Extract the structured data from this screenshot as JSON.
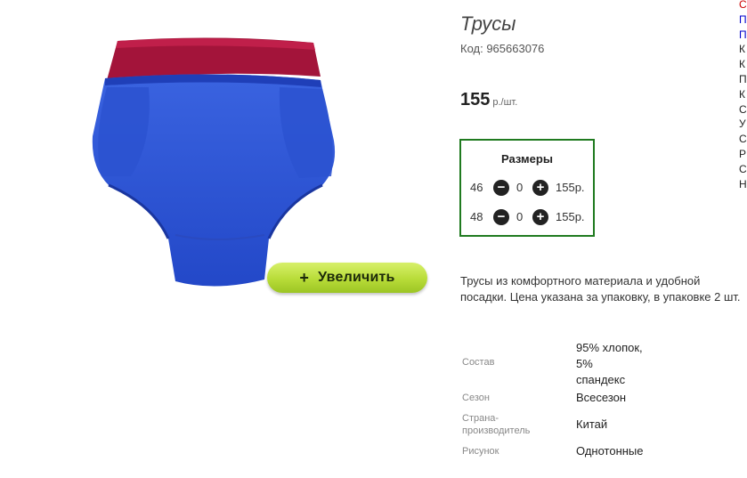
{
  "product": {
    "title": "Трусы",
    "code": "Код: 965663076",
    "price": "155",
    "price_unit": "р./шт.",
    "zoom_label": "Увеличить",
    "zoom_icon": "+",
    "description": "Трусы из комфортного материала и удобной посадки. Цена указана за упаковку, в упаковке 2 шт."
  },
  "sizes": {
    "title": "Размеры",
    "rows": [
      {
        "size": "46",
        "qty": "0",
        "price": "155р."
      },
      {
        "size": "48",
        "qty": "0",
        "price": "155р."
      }
    ]
  },
  "attributes": [
    {
      "label": "Состав",
      "value_lines": [
        "95% хлопок,",
        "5%",
        "спандекс"
      ]
    },
    {
      "label": "Сезон",
      "value": "Всесезон"
    },
    {
      "label_lines": [
        "Страна-",
        "производитель"
      ],
      "value": "Китай"
    },
    {
      "label": "Рисунок",
      "value": "Однотонные"
    }
  ],
  "side_menu": [
    "С",
    "П",
    "П",
    "К",
    "К",
    "П",
    "К",
    "С",
    "У",
    "С",
    "Р",
    "С",
    "Н"
  ],
  "colors": {
    "accent_green": "#1f7a1f",
    "zoom_button": "#b8dc38",
    "link_red": "#cc0000",
    "link_blue": "#0000cc"
  }
}
